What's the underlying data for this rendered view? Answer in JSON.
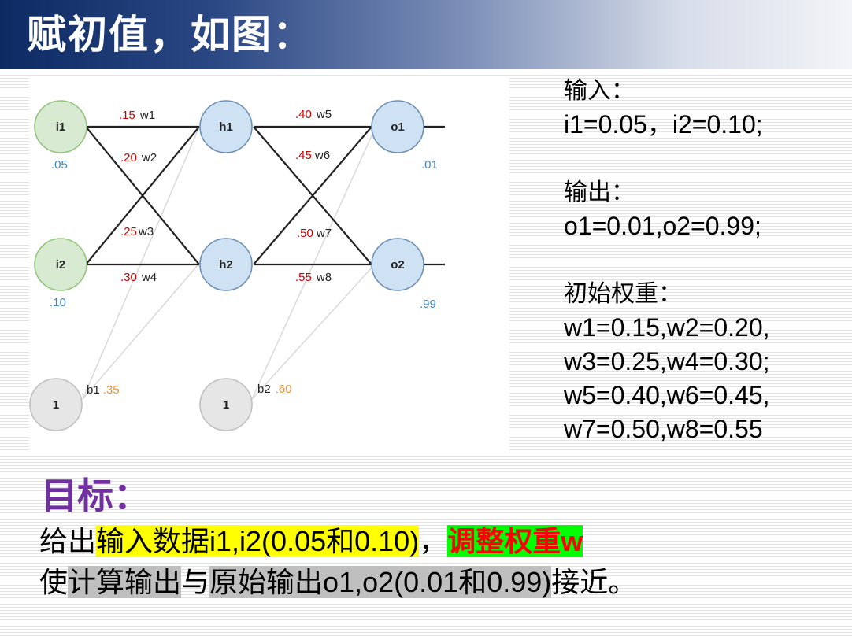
{
  "slide": {
    "title": "赋初值，如图："
  },
  "diagram": {
    "nodes": {
      "i1": "i1",
      "i2": "i2",
      "h1": "h1",
      "h2": "h2",
      "o1": "o1",
      "o2": "o2",
      "b1": "1",
      "b2": "1"
    },
    "weights": [
      {
        "value": ".15",
        "name": "w1"
      },
      {
        "value": ".20",
        "name": "w2"
      },
      {
        "value": ".25",
        "name": "w3"
      },
      {
        "value": ".30",
        "name": "w4"
      },
      {
        "value": ".40",
        "name": "w5"
      },
      {
        "value": ".45",
        "name": "w6"
      },
      {
        "value": ".50",
        "name": "w7"
      },
      {
        "value": ".55",
        "name": "w8"
      }
    ],
    "inputs": {
      "i1": ".05",
      "i2": ".10"
    },
    "outputs": {
      "o1": ".01",
      "o2": ".99"
    },
    "biases": [
      {
        "name": "b1",
        "value": ".35"
      },
      {
        "name": "b2",
        "value": ".60"
      }
    ],
    "colors": {
      "input_fill": "#d9ead3",
      "input_stroke": "#93c47d",
      "hidden_fill": "#cfe2f3",
      "hidden_stroke": "#6d8fb5",
      "bias_fill": "#e6e6e6",
      "bias_stroke": "#c0c0c0",
      "weight_value": "#cc0000",
      "io_value": "#3d85c6",
      "bias_value": "#e69138"
    }
  },
  "info": {
    "input_label": "输入：",
    "input_values": "i1=0.05，i2=0.10;",
    "output_label": "输出：",
    "output_values": "o1=0.01,o2=0.99;",
    "weights_label": "初始权重：",
    "weights_lines": [
      "w1=0.15,w2=0.20,",
      "w3=0.25,w4=0.30;",
      "w5=0.40,w6=0.45,",
      "w7=0.50,w8=0.55"
    ]
  },
  "goal": {
    "title": "目标：",
    "line1_part1": "给出",
    "line1_part2": "输入数据i1,i2(0.05和0.10)",
    "line1_part3": "，",
    "line1_part4": "调整权重w",
    "line2_part1": "使",
    "line2_part2": "计算输出",
    "line2_part3": "与",
    "line2_part4": "原始输出o1,o2(0.01和0.99)",
    "line2_part5": "接近。"
  }
}
